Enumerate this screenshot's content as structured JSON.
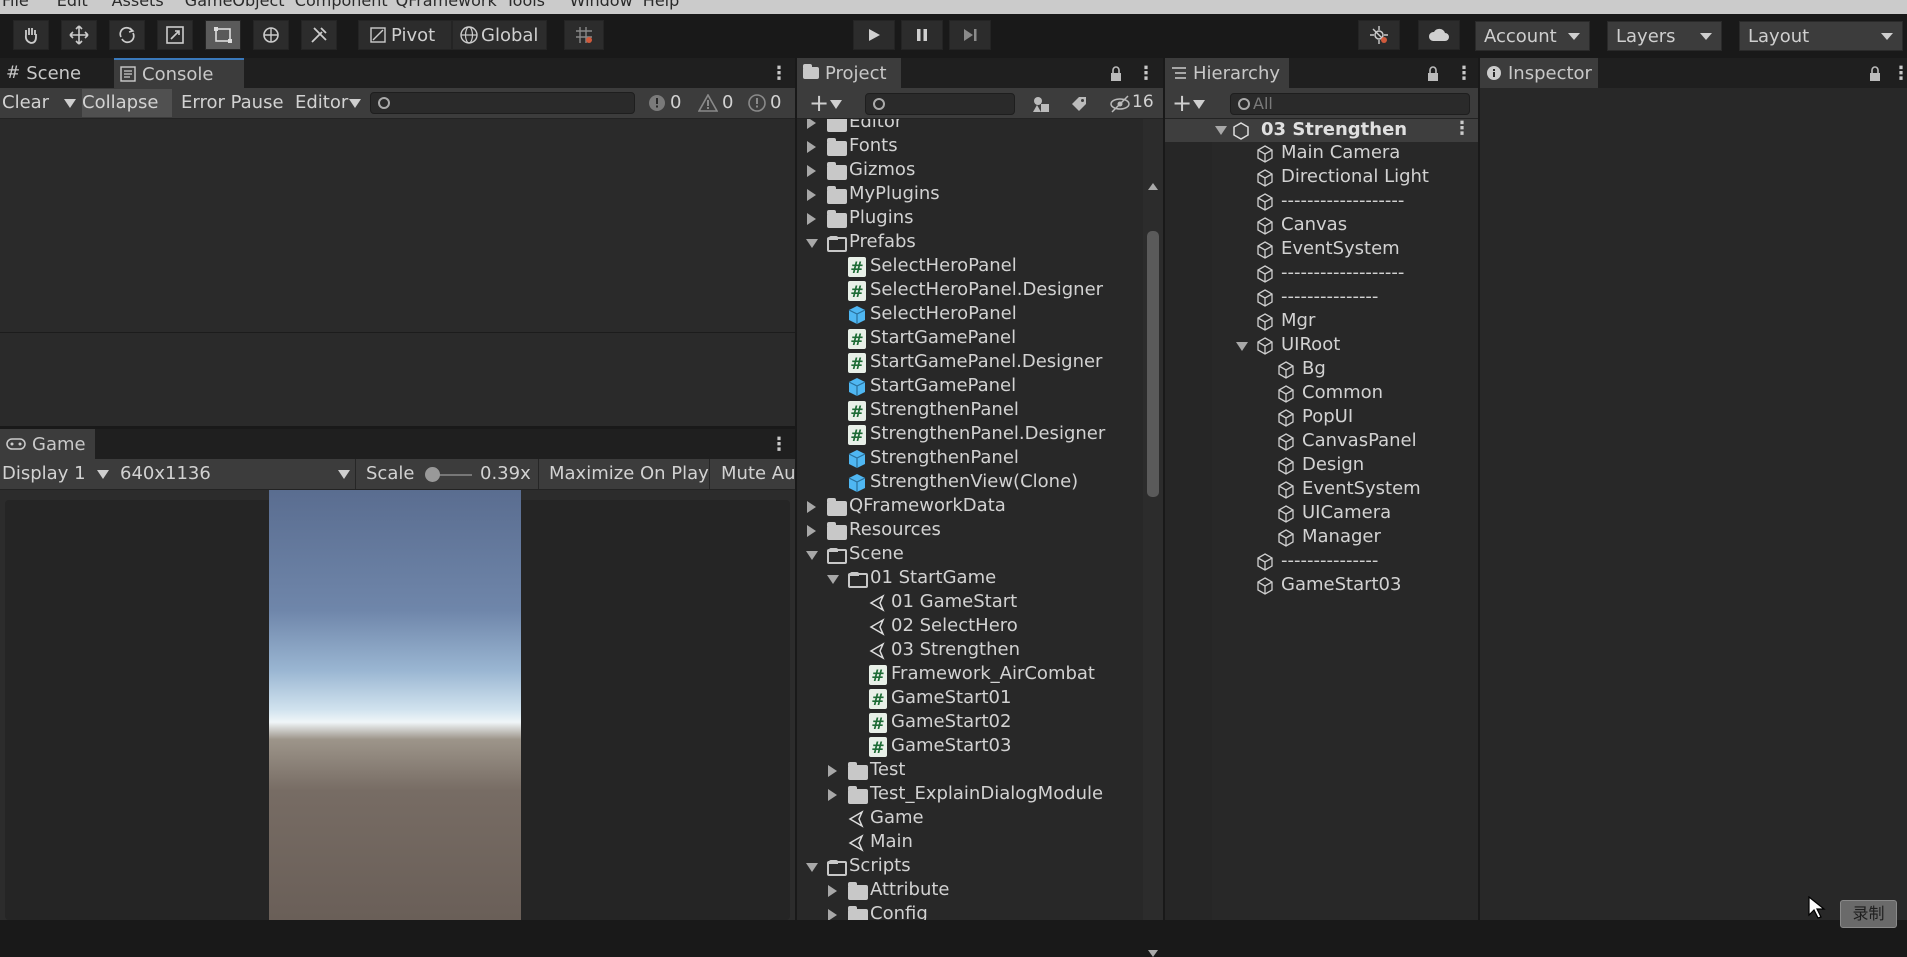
{
  "menu": [
    "File",
    "Edit",
    "Assets",
    "GameObject",
    "Component",
    "QFramework",
    "Tools",
    "Window",
    "Help"
  ],
  "toolbar": {
    "tools": [
      "hand-tool-icon",
      "move-tool-icon",
      "rotate-tool-icon",
      "scale-tool-icon",
      "rect-tool-icon",
      "transform-tool-icon",
      "custom-tool-icon"
    ],
    "pivot_label": "Pivot",
    "global_label": "Global",
    "account_label": "Account",
    "layers_label": "Layers",
    "layout_label": "Layout"
  },
  "scene_panel": {
    "tabs": [
      "Scene",
      "Console"
    ],
    "console_toolbar": {
      "clear": "Clear",
      "collapse": "Collapse",
      "error_pause": "Error Pause",
      "editor": "Editor",
      "log_count": "0",
      "warn_count": "0",
      "error_count": "0"
    }
  },
  "game_panel": {
    "tab": "Game",
    "display": "Display 1",
    "resolution": "640x1136",
    "scale_label": "Scale",
    "scale_value": "0.39x",
    "maximize": "Maximize On Play",
    "mute": "Mute Au"
  },
  "project_panel": {
    "tab": "Project",
    "hidden_count": "16",
    "rows": [
      {
        "label": "Editor",
        "type": "folder",
        "depth": 0,
        "arrow": "right"
      },
      {
        "label": "Fonts",
        "type": "folder",
        "depth": 0,
        "arrow": "right"
      },
      {
        "label": "Gizmos",
        "type": "folder",
        "depth": 0,
        "arrow": "right"
      },
      {
        "label": "MyPlugins",
        "type": "folder",
        "depth": 0,
        "arrow": "right"
      },
      {
        "label": "Plugins",
        "type": "folder",
        "depth": 0,
        "arrow": "right"
      },
      {
        "label": "Prefabs",
        "type": "folder-open",
        "depth": 0,
        "arrow": "down"
      },
      {
        "label": "SelectHeroPanel",
        "type": "cs",
        "depth": 1,
        "arrow": ""
      },
      {
        "label": "SelectHeroPanel.Designer",
        "type": "cs",
        "depth": 1,
        "arrow": ""
      },
      {
        "label": "SelectHeroPanel",
        "type": "prefab",
        "depth": 1,
        "arrow": ""
      },
      {
        "label": "StartGamePanel",
        "type": "cs",
        "depth": 1,
        "arrow": ""
      },
      {
        "label": "StartGamePanel.Designer",
        "type": "cs",
        "depth": 1,
        "arrow": ""
      },
      {
        "label": "StartGamePanel",
        "type": "prefab",
        "depth": 1,
        "arrow": ""
      },
      {
        "label": "StrengthenPanel",
        "type": "cs",
        "depth": 1,
        "arrow": ""
      },
      {
        "label": "StrengthenPanel.Designer",
        "type": "cs",
        "depth": 1,
        "arrow": ""
      },
      {
        "label": "StrengthenPanel",
        "type": "prefab",
        "depth": 1,
        "arrow": ""
      },
      {
        "label": "StrengthenView(Clone)",
        "type": "prefab",
        "depth": 1,
        "arrow": ""
      },
      {
        "label": "QFrameworkData",
        "type": "folder",
        "depth": 0,
        "arrow": "right"
      },
      {
        "label": "Resources",
        "type": "folder",
        "depth": 0,
        "arrow": "right"
      },
      {
        "label": "Scene",
        "type": "folder-open",
        "depth": 0,
        "arrow": "down"
      },
      {
        "label": "01 StartGame",
        "type": "folder-open",
        "depth": 1,
        "arrow": "down"
      },
      {
        "label": "01 GameStart",
        "type": "scene",
        "depth": 2,
        "arrow": ""
      },
      {
        "label": "02 SelectHero",
        "type": "scene",
        "depth": 2,
        "arrow": ""
      },
      {
        "label": "03 Strengthen",
        "type": "scene",
        "depth": 2,
        "arrow": ""
      },
      {
        "label": "Framework_AirCombat",
        "type": "cs",
        "depth": 2,
        "arrow": ""
      },
      {
        "label": "GameStart01",
        "type": "cs",
        "depth": 2,
        "arrow": ""
      },
      {
        "label": "GameStart02",
        "type": "cs",
        "depth": 2,
        "arrow": ""
      },
      {
        "label": "GameStart03",
        "type": "cs",
        "depth": 2,
        "arrow": ""
      },
      {
        "label": "Test",
        "type": "folder",
        "depth": 1,
        "arrow": "right"
      },
      {
        "label": "Test_ExplainDialogModule",
        "type": "folder",
        "depth": 1,
        "arrow": "right"
      },
      {
        "label": "Game",
        "type": "scene",
        "depth": 1,
        "arrow": ""
      },
      {
        "label": "Main",
        "type": "scene",
        "depth": 1,
        "arrow": ""
      },
      {
        "label": "Scripts",
        "type": "folder-open",
        "depth": 0,
        "arrow": "down"
      },
      {
        "label": "Attribute",
        "type": "folder",
        "depth": 1,
        "arrow": "right"
      },
      {
        "label": "Config",
        "type": "folder",
        "depth": 1,
        "arrow": "right"
      }
    ]
  },
  "hierarchy_panel": {
    "tab": "Hierarchy",
    "search_placeholder": "All",
    "scene_name": "03 Strengthen",
    "rows": [
      {
        "label": "Main Camera",
        "depth": 1,
        "arrow": ""
      },
      {
        "label": "Directional Light",
        "depth": 1,
        "arrow": ""
      },
      {
        "label": "-------------------",
        "depth": 1,
        "arrow": ""
      },
      {
        "label": "Canvas",
        "depth": 1,
        "arrow": ""
      },
      {
        "label": "EventSystem",
        "depth": 1,
        "arrow": ""
      },
      {
        "label": "-------------------",
        "depth": 1,
        "arrow": ""
      },
      {
        "label": "---------------",
        "depth": 1,
        "arrow": ""
      },
      {
        "label": "Mgr",
        "depth": 1,
        "arrow": ""
      },
      {
        "label": "UIRoot",
        "depth": 1,
        "arrow": "down"
      },
      {
        "label": "Bg",
        "depth": 2,
        "arrow": ""
      },
      {
        "label": "Common",
        "depth": 2,
        "arrow": ""
      },
      {
        "label": "PopUI",
        "depth": 2,
        "arrow": ""
      },
      {
        "label": "CanvasPanel",
        "depth": 2,
        "arrow": ""
      },
      {
        "label": "Design",
        "depth": 2,
        "arrow": ""
      },
      {
        "label": "EventSystem",
        "depth": 2,
        "arrow": ""
      },
      {
        "label": "UICamera",
        "depth": 2,
        "arrow": ""
      },
      {
        "label": "Manager",
        "depth": 2,
        "arrow": ""
      },
      {
        "label": "---------------",
        "depth": 1,
        "arrow": ""
      },
      {
        "label": "GameStart03",
        "depth": 1,
        "arrow": ""
      }
    ]
  },
  "inspector_panel": {
    "tab": "Inspector"
  },
  "overlay_button": "录制",
  "colors": {
    "accent": "#3a79bb",
    "panel": "#282828",
    "tabbar": "#1f1f1f",
    "prefab": "#4fb7f2",
    "cs": "#1d6b35"
  }
}
